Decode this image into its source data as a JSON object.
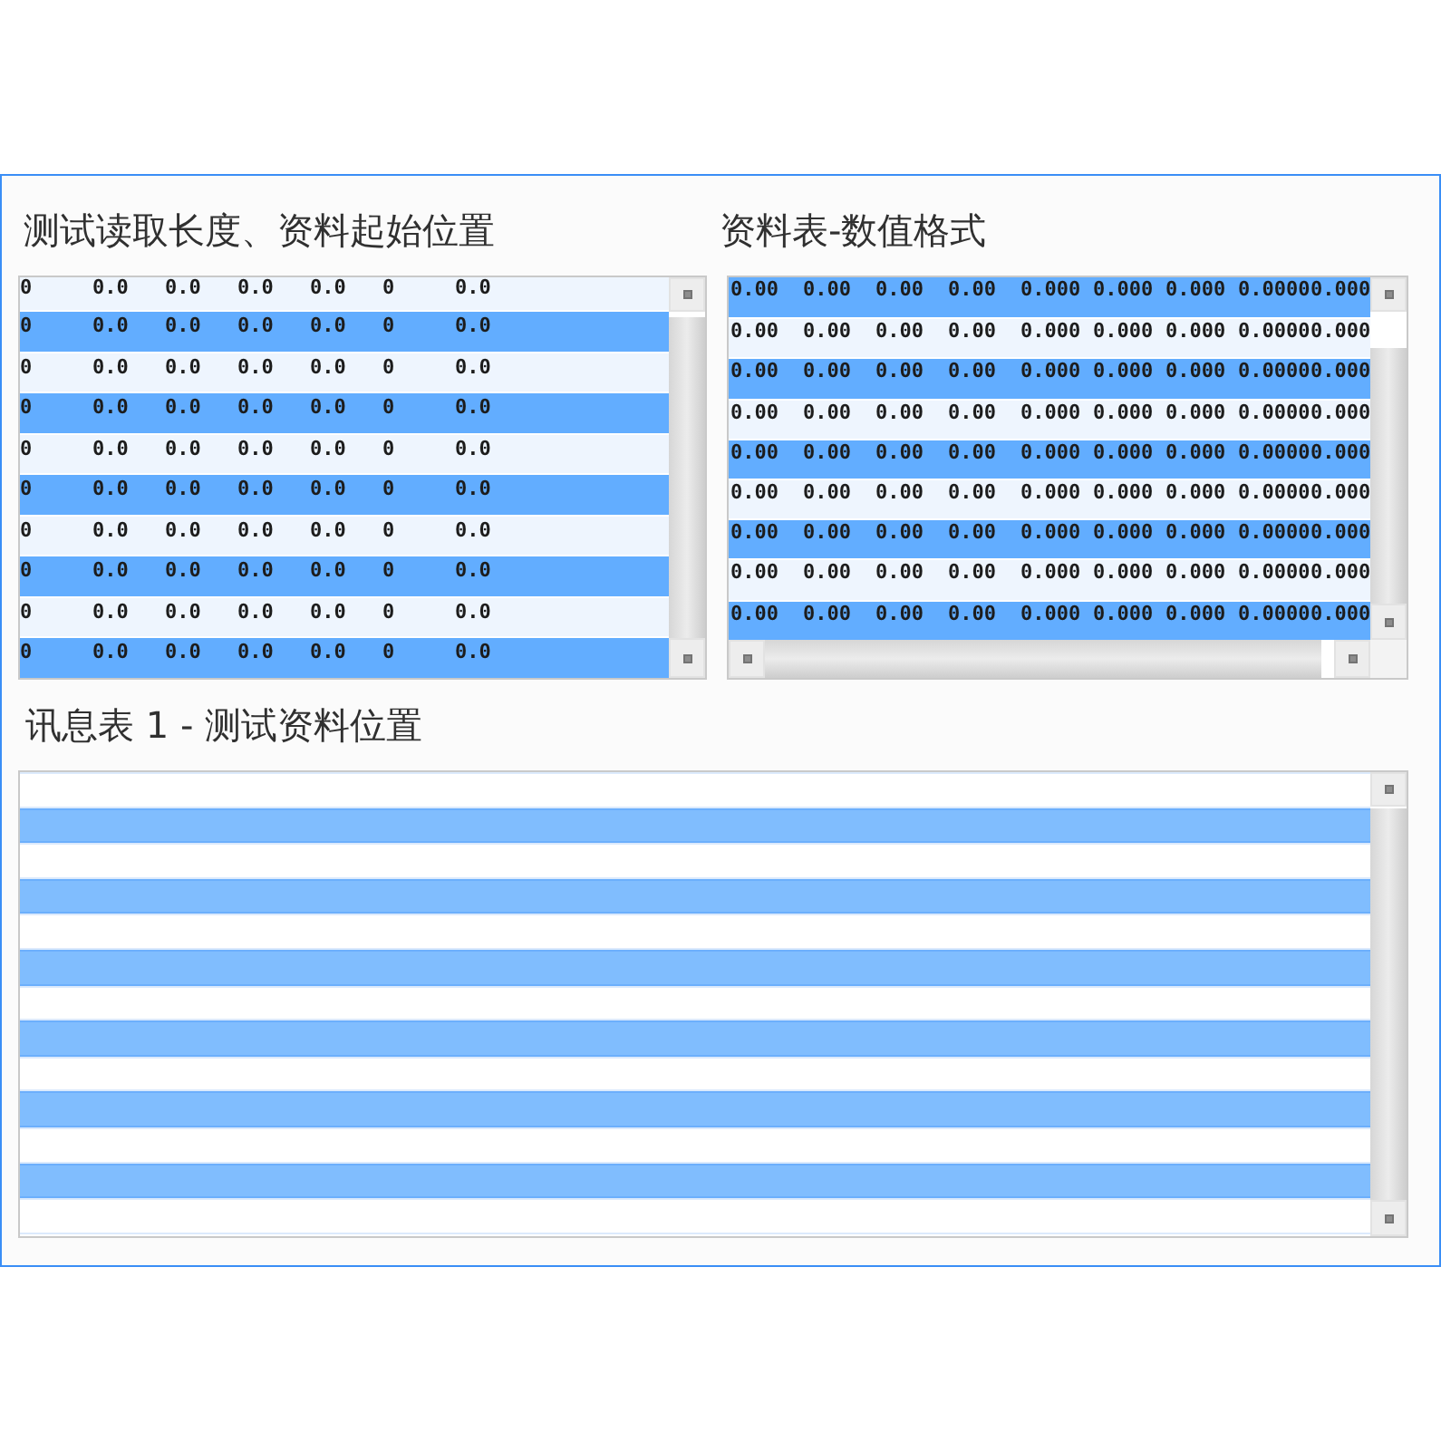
{
  "panels": [
    {
      "title": "测试读取长度、资料起始位置",
      "rows": [
        {
          "shaded": false,
          "cells": [
            "0",
            "0.0",
            "0.0",
            "0.0",
            "0.0",
            "0",
            "0.0"
          ]
        },
        {
          "shaded": true,
          "cells": [
            "0",
            "0.0",
            "0.0",
            "0.0",
            "0.0",
            "0",
            "0.0"
          ]
        },
        {
          "shaded": false,
          "cells": [
            "0",
            "0.0",
            "0.0",
            "0.0",
            "0.0",
            "0",
            "0.0"
          ]
        },
        {
          "shaded": true,
          "cells": [
            "0",
            "0.0",
            "0.0",
            "0.0",
            "0.0",
            "0",
            "0.0"
          ]
        },
        {
          "shaded": false,
          "cells": [
            "0",
            "0.0",
            "0.0",
            "0.0",
            "0.0",
            "0",
            "0.0"
          ]
        },
        {
          "shaded": true,
          "cells": [
            "0",
            "0.0",
            "0.0",
            "0.0",
            "0.0",
            "0",
            "0.0"
          ]
        },
        {
          "shaded": false,
          "cells": [
            "0",
            "0.0",
            "0.0",
            "0.0",
            "0.0",
            "0",
            "0.0"
          ]
        },
        {
          "shaded": true,
          "cells": [
            "0",
            "0.0",
            "0.0",
            "0.0",
            "0.0",
            "0",
            "0.0"
          ]
        },
        {
          "shaded": false,
          "cells": [
            "0",
            "0.0",
            "0.0",
            "0.0",
            "0.0",
            "0",
            "0.0"
          ]
        },
        {
          "shaded": true,
          "cells": [
            "0",
            "0.0",
            "0.0",
            "0.0",
            "0.0",
            "0",
            "0.0"
          ]
        }
      ]
    },
    {
      "title": "资料表-数值格式",
      "rows": [
        {
          "shaded": true,
          "cells": [
            "0.00",
            "0.00",
            "0.00",
            "0.00",
            "0.000",
            "0.000",
            "0.000",
            "0.0000",
            "0.000"
          ]
        },
        {
          "shaded": false,
          "cells": [
            "0.00",
            "0.00",
            "0.00",
            "0.00",
            "0.000",
            "0.000",
            "0.000",
            "0.0000",
            "0.000"
          ]
        },
        {
          "shaded": true,
          "cells": [
            "0.00",
            "0.00",
            "0.00",
            "0.00",
            "0.000",
            "0.000",
            "0.000",
            "0.0000",
            "0.000"
          ]
        },
        {
          "shaded": false,
          "cells": [
            "0.00",
            "0.00",
            "0.00",
            "0.00",
            "0.000",
            "0.000",
            "0.000",
            "0.0000",
            "0.000"
          ]
        },
        {
          "shaded": true,
          "cells": [
            "0.00",
            "0.00",
            "0.00",
            "0.00",
            "0.000",
            "0.000",
            "0.000",
            "0.0000",
            "0.000"
          ]
        },
        {
          "shaded": false,
          "cells": [
            "0.00",
            "0.00",
            "0.00",
            "0.00",
            "0.000",
            "0.000",
            "0.000",
            "0.0000",
            "0.000"
          ]
        },
        {
          "shaded": true,
          "cells": [
            "0.00",
            "0.00",
            "0.00",
            "0.00",
            "0.000",
            "0.000",
            "0.000",
            "0.0000",
            "0.000"
          ]
        },
        {
          "shaded": false,
          "cells": [
            "0.00",
            "0.00",
            "0.00",
            "0.00",
            "0.000",
            "0.000",
            "0.000",
            "0.0000",
            "0.000"
          ]
        },
        {
          "shaded": true,
          "cells": [
            "0.00",
            "0.00",
            "0.00",
            "0.00",
            "0.000",
            "0.000",
            "0.000",
            "0.0000",
            "0.000"
          ]
        }
      ]
    },
    {
      "title": "讯息表 1 - 测试资料位置",
      "rows": [
        {
          "shaded": false
        },
        {
          "shaded": true
        },
        {
          "shaded": false
        },
        {
          "shaded": true
        },
        {
          "shaded": false
        },
        {
          "shaded": true
        },
        {
          "shaded": false
        },
        {
          "shaded": true
        },
        {
          "shaded": false
        },
        {
          "shaded": true
        },
        {
          "shaded": false
        },
        {
          "shaded": true
        },
        {
          "shaded": false
        }
      ]
    }
  ]
}
